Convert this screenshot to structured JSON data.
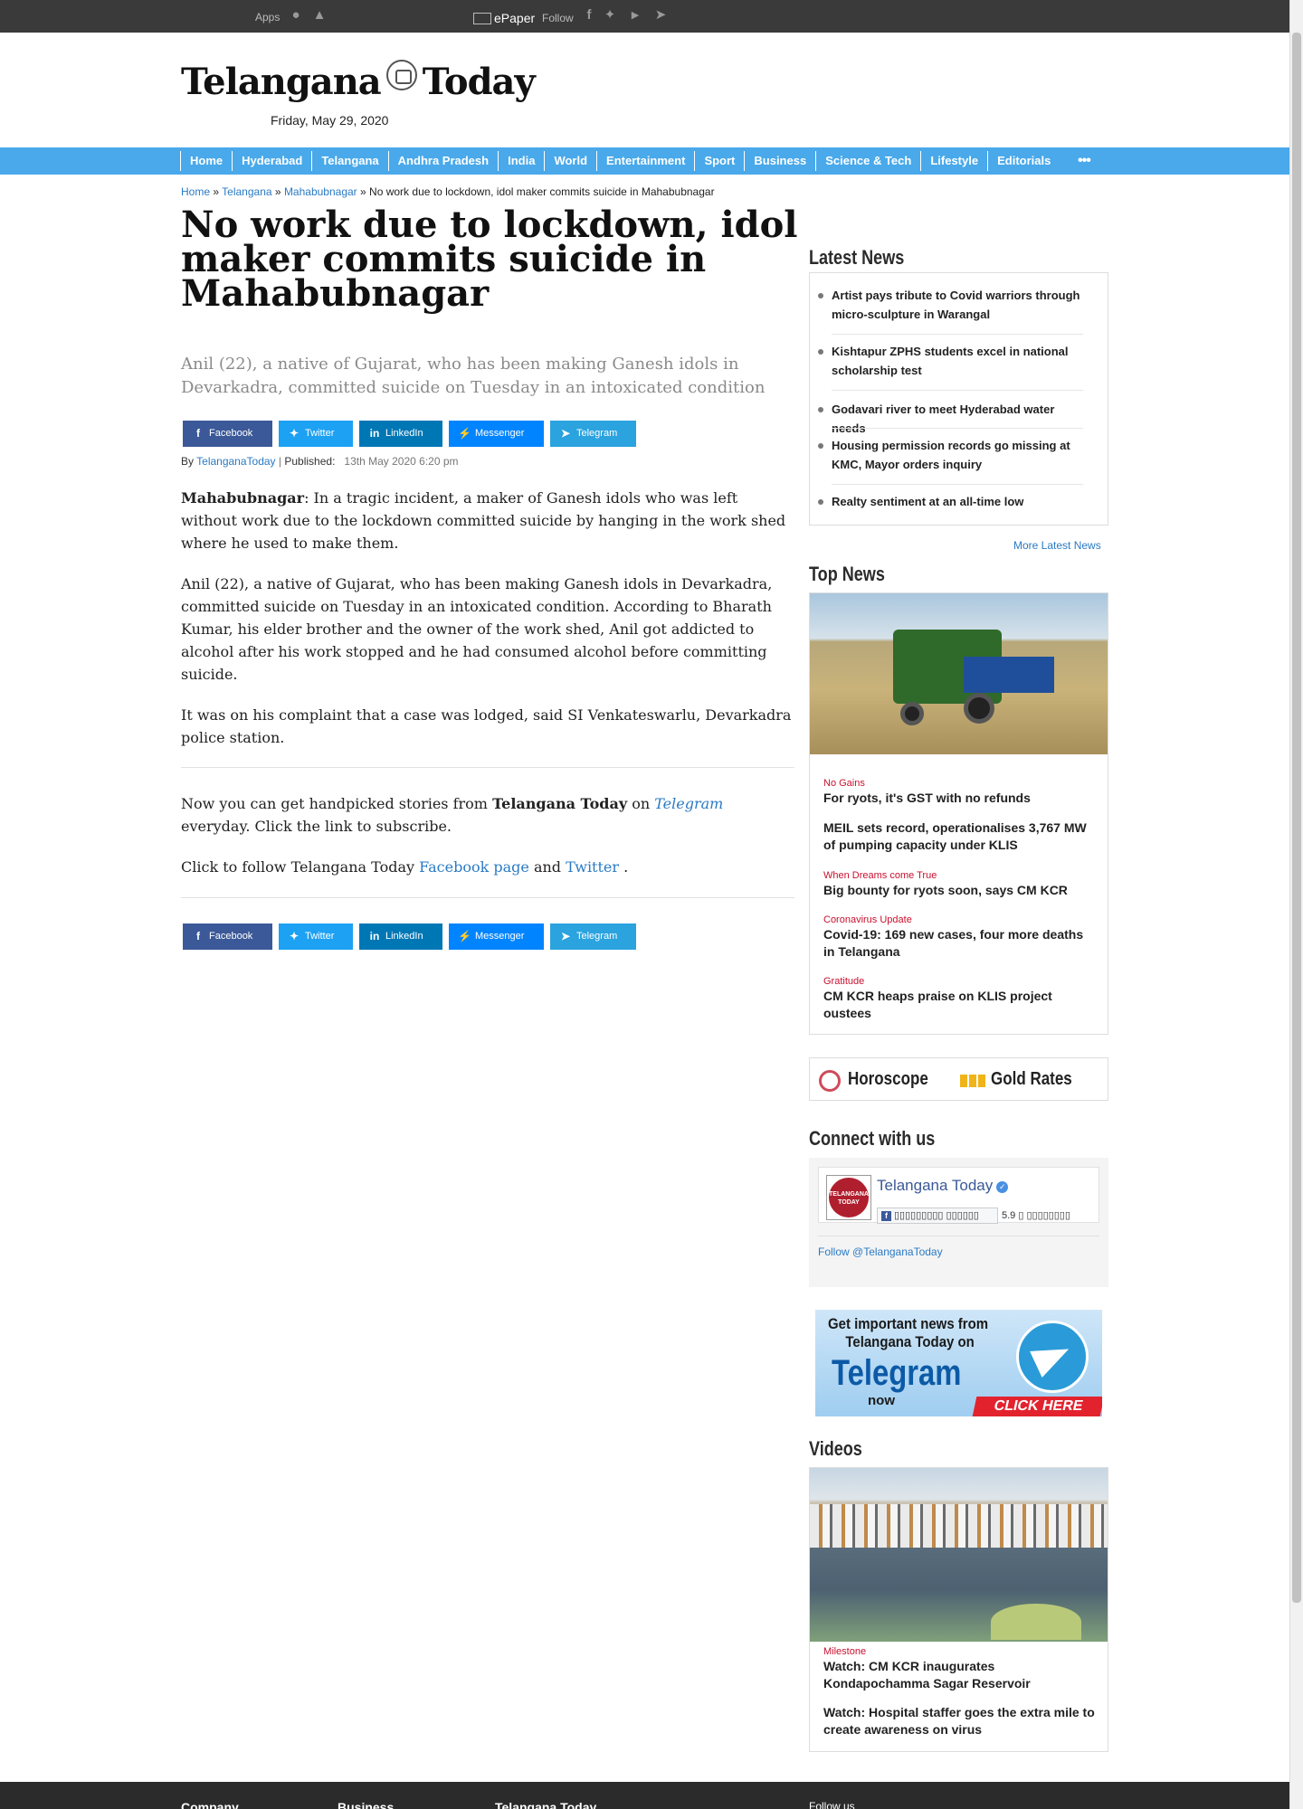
{
  "topbar": {
    "apps_label": "Apps",
    "epaper_label": "ePaper",
    "follow_label": "Follow",
    "icons": [
      "apple-icon",
      "android-icon",
      "facebook-icon",
      "twitter-icon",
      "youtube-icon",
      "telegram-icon"
    ]
  },
  "masthead": {
    "logo_left": "Telangana",
    "logo_right": "Today",
    "date": "Friday, May 29, 2020"
  },
  "nav": {
    "items": [
      "Home",
      "Hyderabad",
      "Telangana",
      "Andhra Pradesh",
      "India",
      "World",
      "Entertainment",
      "Sport",
      "Business",
      "Science & Tech",
      "Lifestyle",
      "Editorials"
    ],
    "more": "•••"
  },
  "breadcrumb": {
    "home": "Home",
    "sep": "»",
    "telangana": "Telangana",
    "district": "Mahabubnagar",
    "current": "No work due to lockdown, idol maker commits suicide in Mahabubnagar"
  },
  "article": {
    "headline": "No work due to lockdown, idol maker commits suicide in Mahabubnagar",
    "deck": "Anil (22), a native of Gujarat, who has been making Ganesh idols in Devarkadra, committed suicide on Tuesday in an intoxicated condition",
    "share": {
      "facebook": "Facebook",
      "twitter": "Twitter",
      "linkedin": "LinkedIn",
      "messenger": "Messenger",
      "telegram": "Telegram"
    },
    "byline": {
      "by": "By",
      "author": "TelanganaToday",
      "sep": "|",
      "published_label": "Published:",
      "date": "13th May 2020",
      "time": "6:20 pm"
    },
    "p1_dateline": "Mahabubnagar",
    "p1_text": ": In a tragic incident, a maker of Ganesh idols who was left without work due to the lockdown committed suicide by hanging in the work shed where he used to make them.",
    "p2": "Anil (22), a native of Gujarat, who has been making Ganesh idols in Devarkadra, committed suicide on Tuesday in an intoxicated condition. According to Bharath Kumar, his elder brother and the owner of the work shed, Anil got addicted to alcohol after his work stopped and he had consumed alcohol before committing suicide.",
    "p3": "It was on his complaint that a case was lodged, said SI Venkateswarlu, Devarkadra police station.",
    "promo1_a": "Now you can get handpicked stories from ",
    "promo1_brand": "Telangana Today",
    "promo1_b": " on ",
    "promo1_link": "Telegram",
    "promo1_c": " everyday. Click the link to subscribe.",
    "promo2_a": "Click to follow Telangana Today ",
    "promo2_fb": "Facebook page",
    "promo2_and": " and ",
    "promo2_tw": "Twitter",
    "promo2_end": " ."
  },
  "latest": {
    "title": "Latest News",
    "items": [
      "Artist pays tribute to Covid warriors through micro-sculpture in Warangal",
      "Kishtapur ZPHS students excel in national scholarship test",
      "Godavari river to meet Hyderabad water needs",
      "Housing permission records go missing at KMC, Mayor orders inquiry",
      "Realty sentiment at an all-time low"
    ],
    "more": "More Latest News"
  },
  "topnews": {
    "title": "Top News",
    "items": [
      {
        "tag": "No Gains",
        "title": "For ryots, it's GST with no refunds"
      },
      {
        "tag": "",
        "title": "MEIL sets record, operationalises 3,767 MW of pumping capacity under KLIS"
      },
      {
        "tag": "When Dreams come True",
        "title": "Big bounty for ryots soon, says CM KCR"
      },
      {
        "tag": "Coronavirus Update",
        "title": "Covid-19: 169 new cases, four more deaths in Telangana"
      },
      {
        "tag": "Gratitude",
        "title": "CM KCR heaps praise on KLIS project oustees"
      }
    ]
  },
  "widgets": {
    "horoscope": "Horoscope",
    "gold": "Gold Rates"
  },
  "connect": {
    "title": "Connect with us",
    "page_name": "Telangana Today",
    "avatar_text": "TELANGANA TODAY",
    "like_label": "▯▯▯▯▯▯▯▯▯ ▯▯▯▯▯▯",
    "count": "5.9 ▯ ▯▯▯▯▯▯▯▯",
    "follow": "Follow @TelanganaToday"
  },
  "telegram_promo": {
    "line1": "Get important news from",
    "line2": "Telangana Today on",
    "brand": "Telegram",
    "now": "now",
    "cta": "CLICK HERE"
  },
  "videos": {
    "title": "Videos",
    "items": [
      {
        "tag": "Milestone",
        "title": "Watch: CM KCR inaugurates Kondapochamma Sagar Reservoir"
      },
      {
        "tag": "",
        "title": "Watch: Hospital staffer goes the extra mile to create awareness on virus"
      }
    ]
  },
  "footer": {
    "company": "Company",
    "business": "Business",
    "brand": "Telangana Today",
    "follow": "Follow us"
  }
}
